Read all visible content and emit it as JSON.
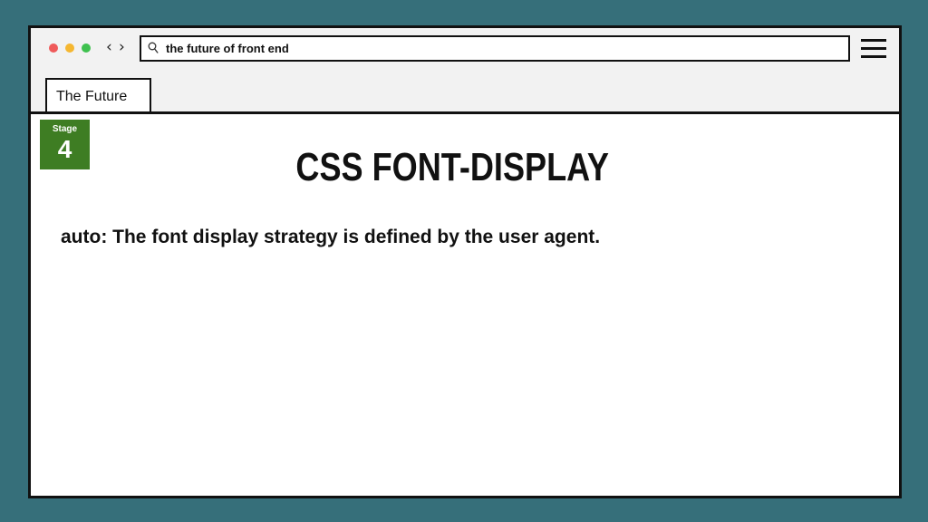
{
  "window": {
    "controls": [
      "close",
      "minimize",
      "maximize"
    ]
  },
  "navigation": {
    "back_icon": "chevron-left-icon",
    "back_glyph": "‹",
    "forward_icon": "chevron-right-icon",
    "forward_glyph": "›"
  },
  "address_bar": {
    "icon": "search-icon",
    "value": "the future of front end"
  },
  "menu": {
    "icon": "hamburger-menu-icon"
  },
  "tab": {
    "label": "The Future"
  },
  "stage_badge": {
    "label": "Stage",
    "number": "4",
    "color": "#3e7d23"
  },
  "content": {
    "title": "CSS FONT-DISPLAY",
    "description": "auto: The font display strategy is defined by the user agent."
  },
  "colors": {
    "background": "#366f7a",
    "window_border": "#111111",
    "chrome": "#f2f2f2",
    "close": "#ef5a5a",
    "minimize": "#f5b731",
    "maximize": "#3fc14f"
  }
}
